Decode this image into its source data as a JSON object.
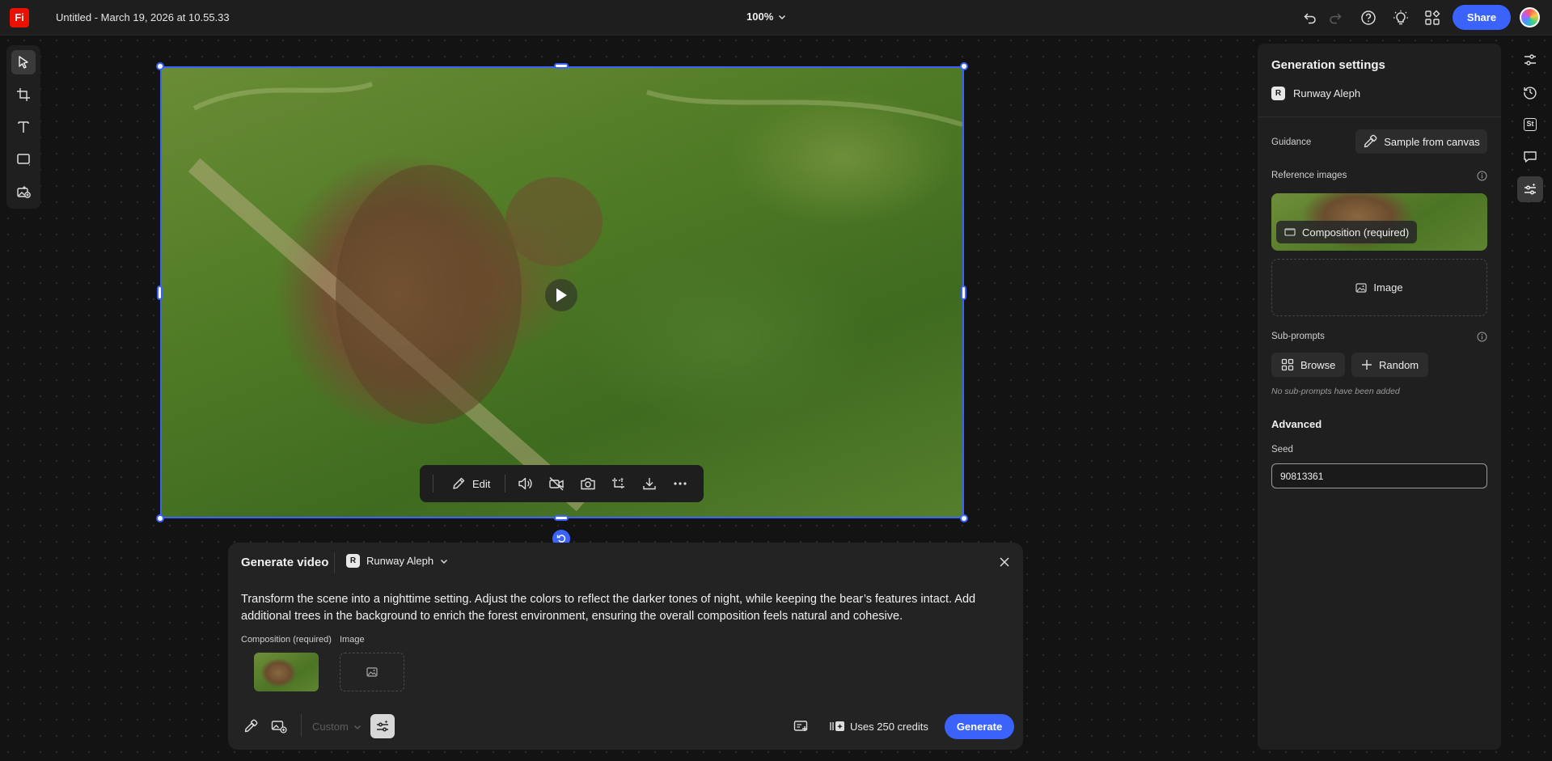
{
  "app": {
    "logo_text": "Fi",
    "doc_title": "Untitled - March 19, 2026 at 10.55.33",
    "zoom": "100%",
    "share_label": "Share"
  },
  "colors": {
    "accent": "#3b63fb",
    "brand": "#eb1000"
  },
  "left_toolbar": [
    "select-icon",
    "artboard-icon",
    "text-icon",
    "shape-icon",
    "generate-image-icon"
  ],
  "video_toolbar": {
    "edit_label": "Edit",
    "icons": [
      "volume-icon",
      "mute-video-icon",
      "camera-icon",
      "crop-icon",
      "download-icon",
      "more-icon"
    ]
  },
  "gen_panel": {
    "title": "Generate video",
    "model": "Runway Aleph",
    "prompt": "Transform the scene into a nighttime setting. Adjust the colors to reflect the darker tones of night, while keeping the bear’s features intact. Add additional trees in the background to enrich the forest environment, ensuring the overall composition feels natural and cohesive.",
    "composition_label": "Composition (required)",
    "image_label": "Image",
    "custom_label": "Custom",
    "credits": "Uses 250 credits",
    "generate_label": "Generate"
  },
  "settings": {
    "title": "Generation settings",
    "model": "Runway Aleph",
    "guidance_label": "Guidance",
    "sample_label": "Sample from canvas",
    "reference_label": "Reference images",
    "composition_tag": "Composition (required)",
    "image_label": "Image",
    "subprompts_label": "Sub-prompts",
    "browse_label": "Browse",
    "random_label": "Random",
    "no_subprompts": "No sub-prompts have been added",
    "advanced_label": "Advanced",
    "seed_label": "Seed",
    "seed_value": "90813361"
  },
  "model_logo_text": "R",
  "right_rail": [
    "sliders-icon",
    "history-icon",
    "stock-icon",
    "comment-icon",
    "generation-settings-icon"
  ],
  "stock_badge": "St"
}
